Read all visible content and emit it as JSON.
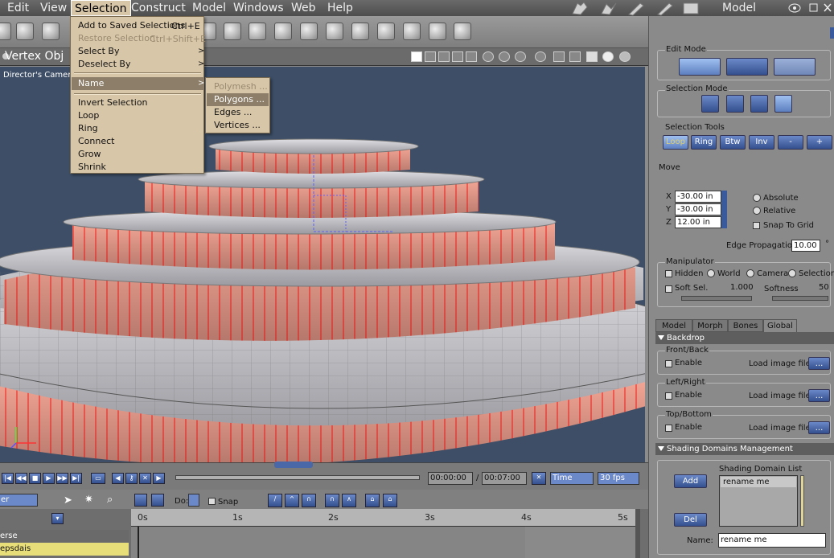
{
  "menubar": {
    "items": [
      "Edit",
      "View",
      "Selection",
      "Construct",
      "Model",
      "Windows",
      "Web",
      "Help"
    ],
    "active": "Selection",
    "mode_title": "Model"
  },
  "viewport": {
    "title": "Vertex Obj",
    "camera": "Director's Camera"
  },
  "selection_menu": {
    "items": [
      {
        "label": "Add to Saved Selections",
        "shortcut": "Ctrl+E",
        "disabled": false
      },
      {
        "label": "Restore Selection",
        "shortcut": "Ctrl+Shift+E",
        "disabled": true
      },
      {
        "label": "Select By",
        "submenu": true
      },
      {
        "label": "Deselect By",
        "submenu": true
      },
      {
        "label": "Name",
        "submenu": true,
        "highlighted": true
      },
      {
        "label": "Invert Selection"
      },
      {
        "label": "Loop"
      },
      {
        "label": "Ring"
      },
      {
        "label": "Connect"
      },
      {
        "label": "Grow"
      },
      {
        "label": "Shrink"
      }
    ]
  },
  "name_submenu": {
    "items": [
      {
        "label": "Polymesh ...",
        "disabled": true
      },
      {
        "label": "Polygons ...",
        "selected": true
      },
      {
        "label": "Edges ..."
      },
      {
        "label": "Vertices ..."
      }
    ]
  },
  "panel": {
    "edit_mode_label": "Edit Mode",
    "selection_mode_label": "Selection Mode",
    "selection_tools_label": "Selection Tools",
    "tool_buttons": [
      "Loop",
      "Ring",
      "Btw",
      "Inv",
      "-",
      "+"
    ],
    "move_label": "Move",
    "x_label": "X",
    "x_value": "-30.00 in",
    "y_label": "Y",
    "y_value": "-30.00 in",
    "z_label": "Z",
    "z_value": "12.00 in",
    "absolute": "Absolute",
    "relative": "Relative",
    "snap_to_grid": "Snap To Grid",
    "edge_propagation_label": "Edge Propagation",
    "edge_propagation_value": "10.00",
    "degree_symbol": "°",
    "manipulator_label": "Manipulator",
    "hidden": "Hidden",
    "world": "World",
    "camera": "Camera",
    "selection": "Selection",
    "soft_sel": "Soft Sel.",
    "soft_sel_value": "1.000",
    "softness": "Softness",
    "softness_value": "50",
    "tabs": [
      "Model",
      "Morph",
      "Bones",
      "Global"
    ],
    "backdrop": "Backdrop",
    "front_back": "Front/Back",
    "left_right": "Left/Right",
    "top_bottom": "Top/Bottom",
    "enable": "Enable",
    "load_image": "Load image file:",
    "browse": "...",
    "shading_header": "Shading Domains Management",
    "shading_list_label": "Shading Domain List",
    "shading_item": "rename me",
    "add": "Add",
    "del": "Del",
    "name_label": "Name:",
    "name_value": "rename me"
  },
  "timeline": {
    "time_current": "00:00:00",
    "time_sep": "/",
    "time_total": "00:07:00",
    "time_mode": "Time",
    "fps": "30 fps",
    "do_label": "Do:",
    "snap": "Snap",
    "ruler_ticks": [
      "0s",
      "1s",
      "2s",
      "3s",
      "4s",
      "5s"
    ],
    "rows": [
      "erse",
      "epsdais"
    ],
    "dropdown_value": "er"
  }
}
